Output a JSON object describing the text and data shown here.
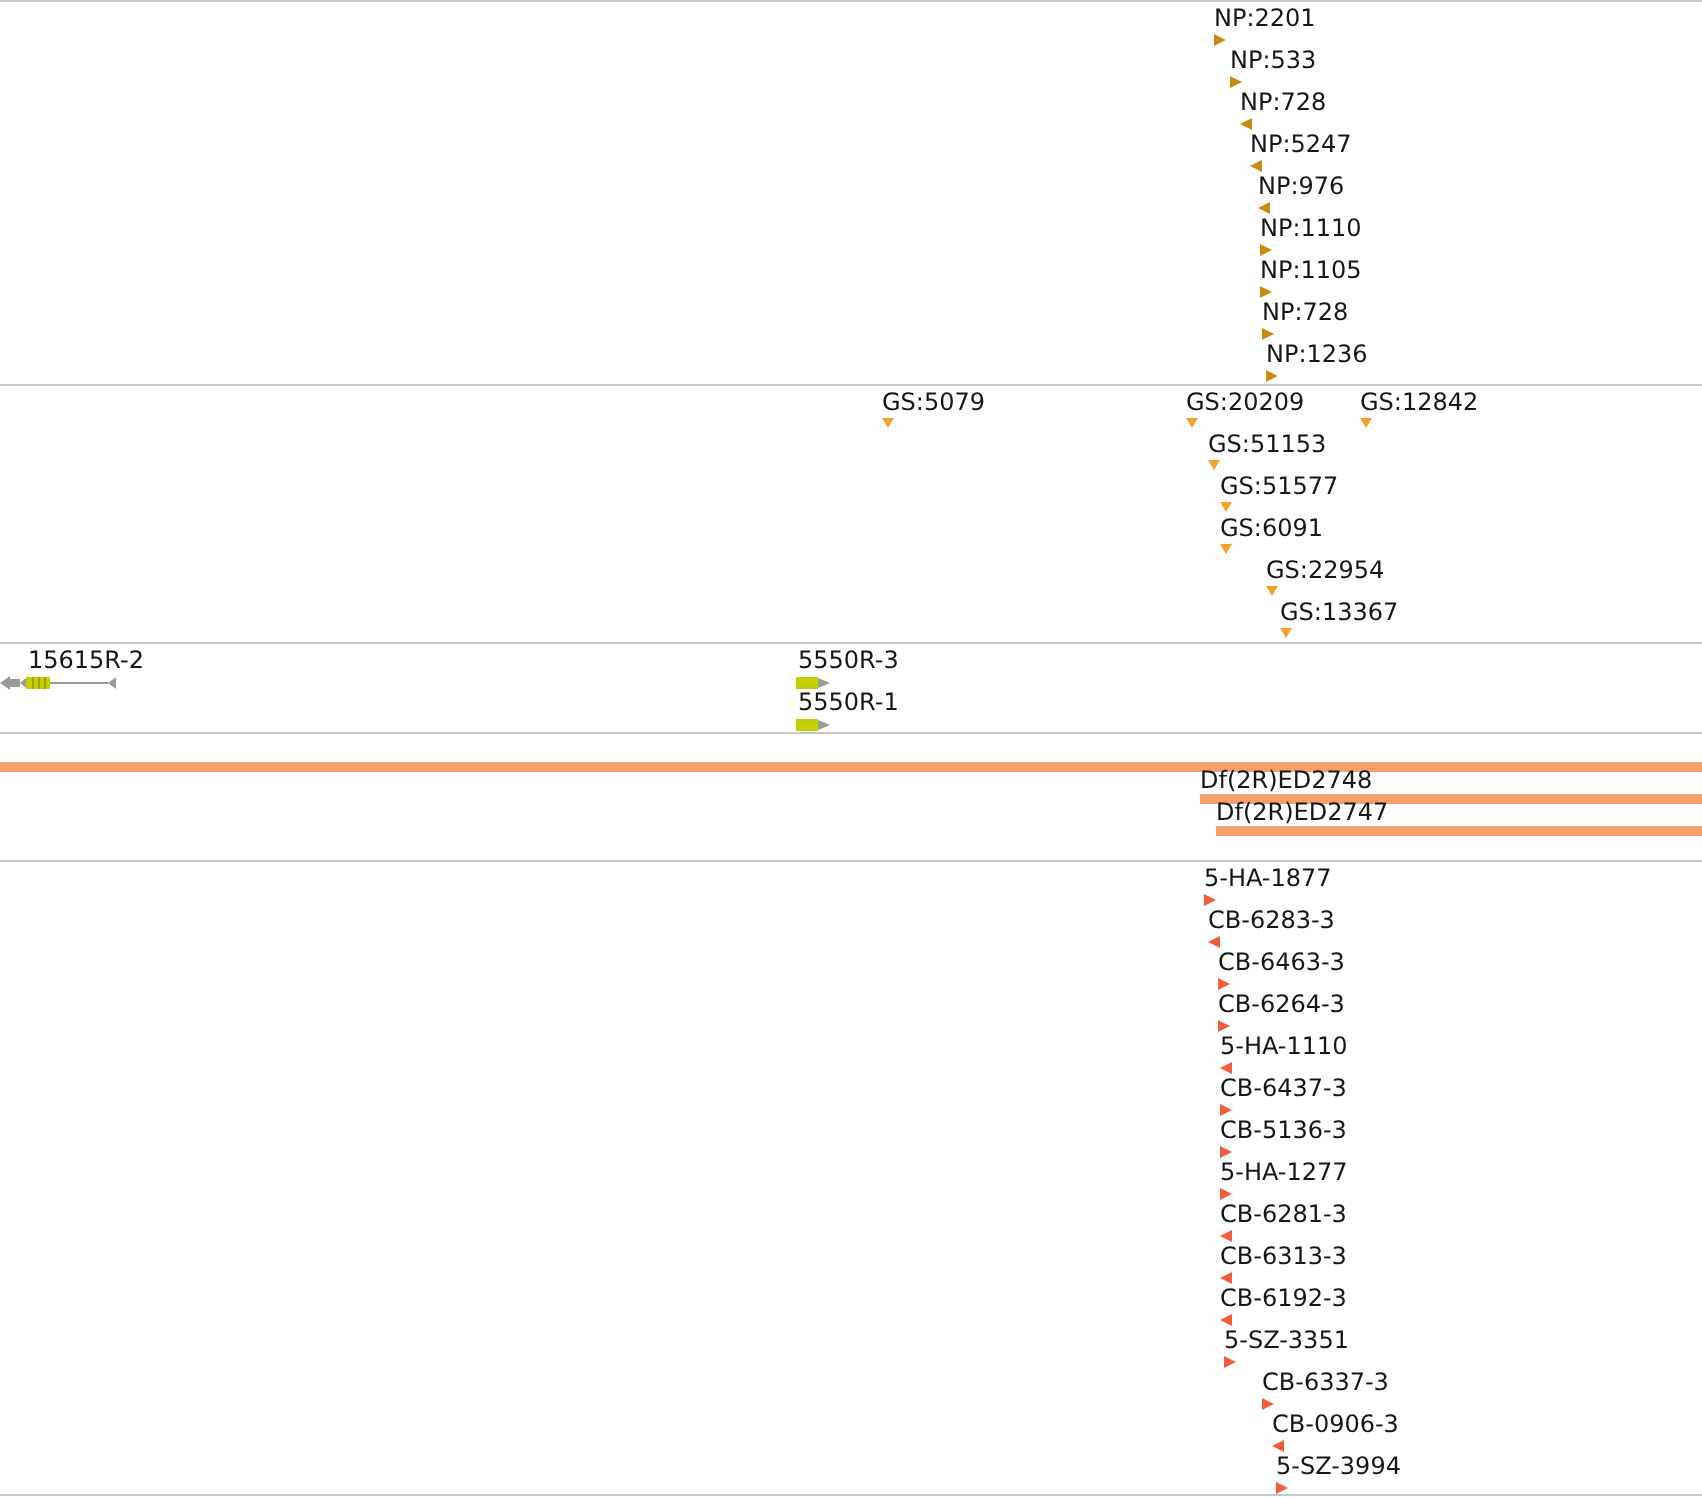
{
  "tracks": [
    {
      "kind": "markers",
      "color": "#c98a10",
      "features": [
        {
          "label": "NP:2201",
          "reverse": false
        },
        {
          "label": "NP:533",
          "reverse": false
        },
        {
          "label": "NP:728",
          "reverse": true
        },
        {
          "label": "NP:5247",
          "reverse": true
        },
        {
          "label": "NP:976",
          "reverse": true
        },
        {
          "label": "NP:1110",
          "reverse": false
        },
        {
          "label": "NP:1105",
          "reverse": false
        },
        {
          "label": "NP:728",
          "reverse": false
        },
        {
          "label": "NP:1236",
          "reverse": false
        }
      ]
    },
    {
      "kind": "markers",
      "color": "#f0a428",
      "features": [
        {
          "label": "GS:5079"
        },
        {
          "label": "GS:20209"
        },
        {
          "label": "GS:12842"
        },
        {
          "label": "GS:51153"
        },
        {
          "label": "GS:51577"
        },
        {
          "label": "GS:6091"
        },
        {
          "label": "GS:22954"
        },
        {
          "label": "GS:13367"
        }
      ]
    },
    {
      "kind": "genes",
      "color": "#c4d000",
      "features": [
        {
          "label": "15615R-2",
          "reverse": true
        },
        {
          "label": "5550R-3",
          "reverse": false
        },
        {
          "label": "5550R-1",
          "reverse": false
        }
      ]
    },
    {
      "kind": "bars",
      "color": "#f4a06c",
      "features": [
        {
          "continues_left": true
        },
        {
          "label": "Df(2R)ED2748",
          "continues_left": false
        },
        {
          "label": "Df(2R)ED2747",
          "continues_left": false
        }
      ]
    },
    {
      "kind": "markers",
      "color": "#f25c3c",
      "features": [
        {
          "label": "5-HA-1877",
          "reverse": false
        },
        {
          "label": "CB-6283-3",
          "reverse": true
        },
        {
          "label": "CB-6463-3",
          "reverse": false
        },
        {
          "label": "CB-6264-3",
          "reverse": false
        },
        {
          "label": "5-HA-1110",
          "reverse": true
        },
        {
          "label": "CB-6437-3",
          "reverse": false
        },
        {
          "label": "CB-5136-3",
          "reverse": false
        },
        {
          "label": "5-HA-1277",
          "reverse": false
        },
        {
          "label": "CB-6281-3",
          "reverse": true
        },
        {
          "label": "CB-6313-3",
          "reverse": true
        },
        {
          "label": "CB-6192-3",
          "reverse": true
        },
        {
          "label": "5-SZ-3351",
          "reverse": false
        },
        {
          "label": "CB-6337-3",
          "reverse": false
        },
        {
          "label": "CB-0906-3",
          "reverse": true
        },
        {
          "label": "5-SZ-3994",
          "reverse": false
        }
      ]
    }
  ]
}
